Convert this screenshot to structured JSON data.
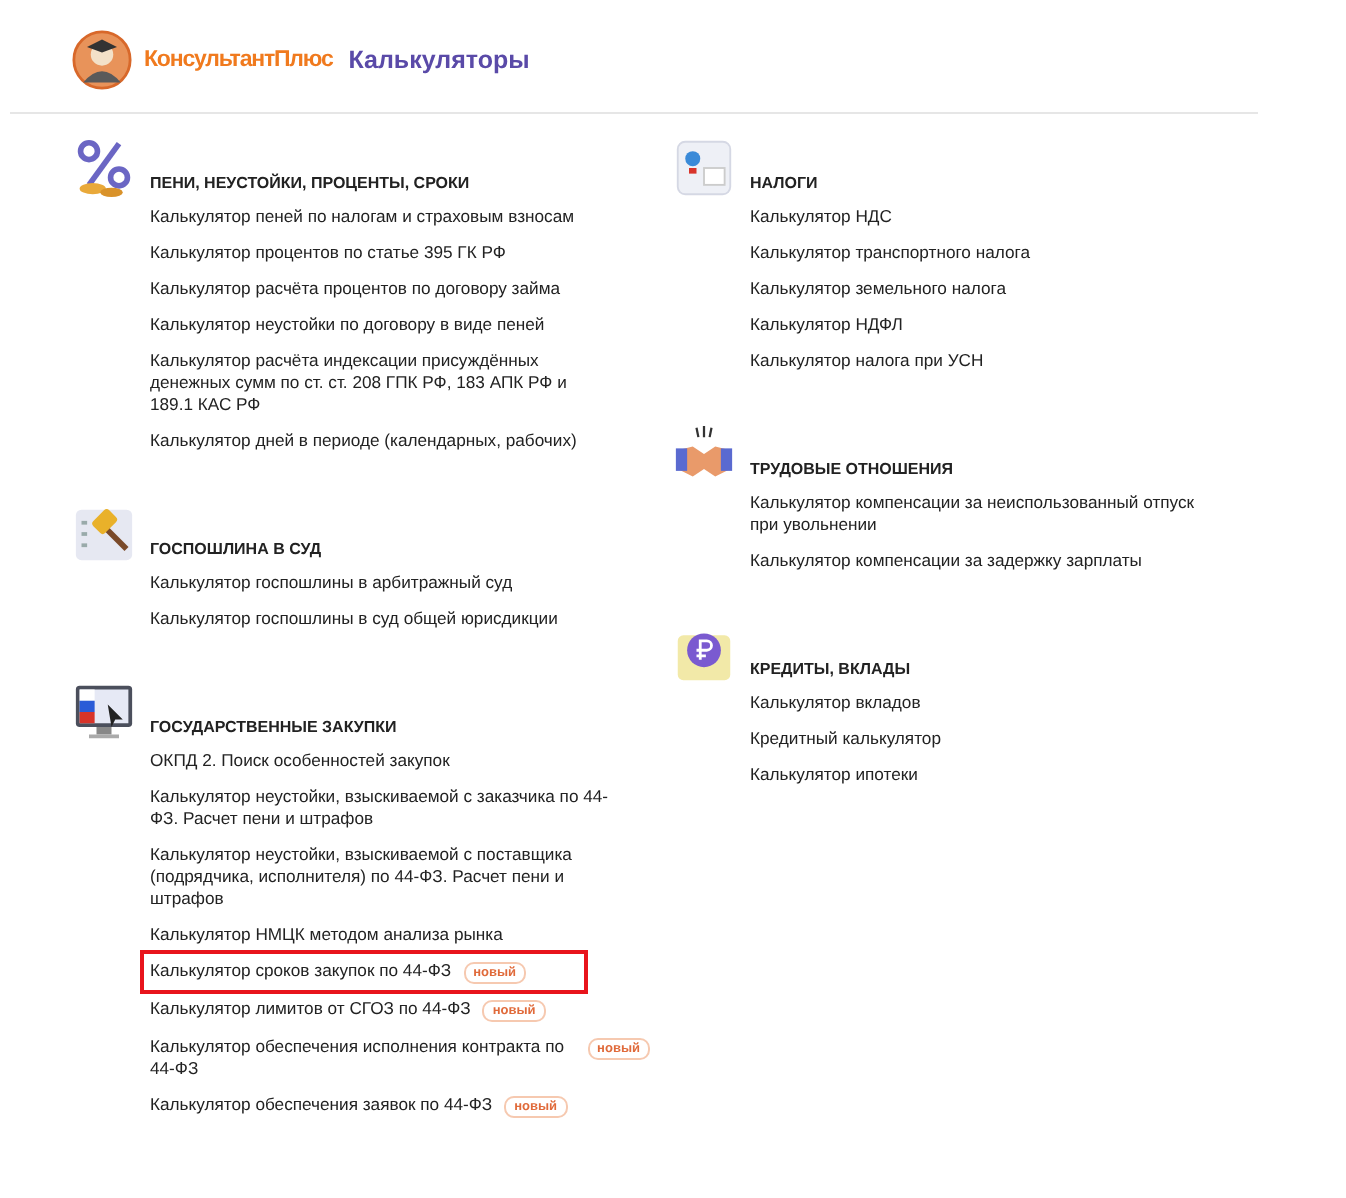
{
  "header": {
    "brand": "КонсультантПлюс",
    "title": "Калькуляторы"
  },
  "columns": [
    {
      "sections": [
        {
          "kind": "percent",
          "title": "ПЕНИ, НЕУСТОЙКИ, ПРОЦЕНТЫ, СРОКИ",
          "items": [
            {
              "label": "Калькулятор пеней по налогам и страховым взносам",
              "highlighted": false
            },
            {
              "label": "Калькулятор процентов по статье 395 ГК РФ",
              "highlighted": false
            },
            {
              "label": "Калькулятор расчёта процентов по договору займа",
              "highlighted": false
            },
            {
              "label": "Калькулятор неустойки по договору в виде пеней",
              "highlighted": false
            },
            {
              "label": "Калькулятор расчёта индексации присуждённых денежных сумм по ст. ст. 208 ГПК РФ, 183 АПК РФ и 189.1 КАС РФ",
              "highlighted": false
            },
            {
              "label": "Калькулятор дней в периоде (календарных, рабочих)",
              "highlighted": false
            }
          ]
        },
        {
          "kind": "gavel",
          "title": "ГОСПОШЛИНА В СУД",
          "items": [
            {
              "label": "Калькулятор госпошлины в арбитражный суд",
              "highlighted": false
            },
            {
              "label": "Калькулятор госпошлины в суд общей юрисдикции",
              "highlighted": false
            }
          ]
        },
        {
          "kind": "monitor",
          "title": "ГОСУДАРСТВЕННЫЕ ЗАКУПКИ",
          "items": [
            {
              "label": "ОКПД 2. Поиск особенностей закупок",
              "highlighted": false
            },
            {
              "label": "Калькулятор неустойки, взыскиваемой с заказчика по 44-ФЗ. Расчет пени и штрафов",
              "highlighted": false
            },
            {
              "label": "Калькулятор неустойки, взыскиваемой с поставщика (подрядчика, исполнителя) по 44-ФЗ. Расчет пени и штрафов",
              "highlighted": false
            },
            {
              "label": "Калькулятор НМЦК методом анализа рынка",
              "highlighted": false
            },
            {
              "label": "Калькулятор сроков закупок по 44-ФЗ",
              "new_badge": "новый",
              "highlighted": true
            },
            {
              "label": "Калькулятор лимитов от СГОЗ по 44-ФЗ",
              "new_badge": "новый",
              "highlighted": false
            },
            {
              "label": "Калькулятор обеспечения исполнения контракта по 44-ФЗ",
              "new_badge": "новый",
              "highlighted": false
            },
            {
              "label": "Калькулятор обеспечения заявок по 44-ФЗ",
              "new_badge": "новый",
              "highlighted": false
            }
          ]
        }
      ]
    },
    {
      "sections": [
        {
          "kind": "tax",
          "title": "НАЛОГИ",
          "items": [
            {
              "label": "Калькулятор НДС",
              "highlighted": false
            },
            {
              "label": "Калькулятор транспортного налога",
              "highlighted": false
            },
            {
              "label": "Калькулятор земельного налога",
              "highlighted": false
            },
            {
              "label": "Калькулятор НДФЛ",
              "highlighted": false
            },
            {
              "label": "Калькулятор налога при УСН",
              "highlighted": false
            }
          ]
        },
        {
          "kind": "handshake",
          "title": "ТРУДОВЫЕ ОТНОШЕНИЯ",
          "items": [
            {
              "label": "Калькулятор компенсации за неиспользованный отпуск при увольнении",
              "highlighted": false
            },
            {
              "label": "Калькулятор компенсации за задержку зарплаты",
              "highlighted": false
            }
          ]
        },
        {
          "kind": "ruble",
          "title": "КРЕДИТЫ, ВКЛАДЫ",
          "items": [
            {
              "label": "Калькулятор вкладов",
              "highlighted": false
            },
            {
              "label": "Кредитный калькулятор",
              "highlighted": false
            },
            {
              "label": "Калькулятор ипотеки",
              "highlighted": false
            }
          ]
        }
      ]
    }
  ]
}
